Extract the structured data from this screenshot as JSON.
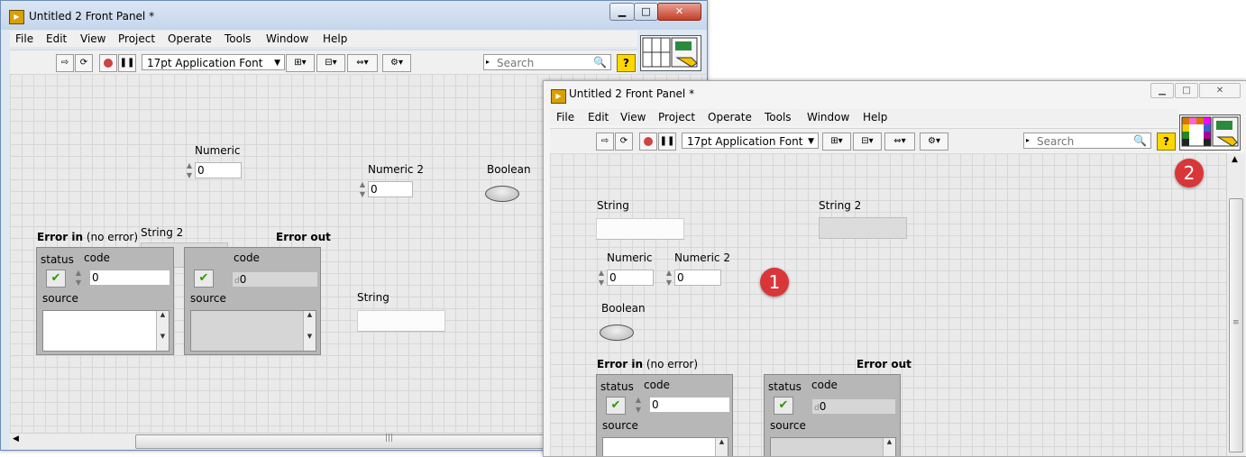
{
  "window1": {
    "title": "Untitled 2 Front Panel *",
    "menu": [
      "File",
      "Edit",
      "View",
      "Project",
      "Operate",
      "Tools",
      "Window",
      "Help"
    ],
    "toolbar": {
      "font": "17pt Application Font",
      "search_placeholder": "Search",
      "help": "?"
    },
    "controls": {
      "numeric_label": "Numeric",
      "numeric_value": "0",
      "numeric2_label": "Numeric 2",
      "numeric2_value": "0",
      "boolean_label": "Boolean",
      "string2_label": "String 2",
      "string_label": "String",
      "error_in_label": "Error in",
      "error_in_suffix": "(no error)",
      "error_out_label": "Error out",
      "status_label": "status",
      "code_label": "code",
      "code_value": "0",
      "source_label": "source",
      "code_prefix": "d"
    }
  },
  "window2": {
    "title": "Untitled 2 Front Panel *",
    "menu": [
      "File",
      "Edit",
      "View",
      "Project",
      "Operate",
      "Tools",
      "Window",
      "Help"
    ],
    "toolbar": {
      "font": "17pt Application Font",
      "search_placeholder": "Search",
      "help": "?"
    },
    "controls": {
      "string_label": "String",
      "string2_label": "String 2",
      "numeric_label": "Numeric",
      "numeric_value": "0",
      "numeric2_label": "Numeric 2",
      "numeric2_value": "0",
      "boolean_label": "Boolean",
      "error_in_label": "Error in",
      "error_in_suffix": "(no error)",
      "error_out_label": "Error out",
      "status_label": "status",
      "code_label": "code",
      "code_value": "0",
      "source_label": "source",
      "code_prefix": "d"
    },
    "badges": [
      "1",
      "2"
    ]
  },
  "colors": {
    "badge": "#d9363a",
    "panel_bg": "#eaeaea",
    "grid": "#d7d7d7",
    "check": "#2c9a00"
  },
  "icons": [
    "run-arrow-icon",
    "run-continuous-icon",
    "abort-icon",
    "pause-icon",
    "align-icon",
    "distribute-icon",
    "resize-icon",
    "reorder-icon",
    "search-icon",
    "help-icon",
    "connector-pane-icon",
    "vi-icon"
  ]
}
